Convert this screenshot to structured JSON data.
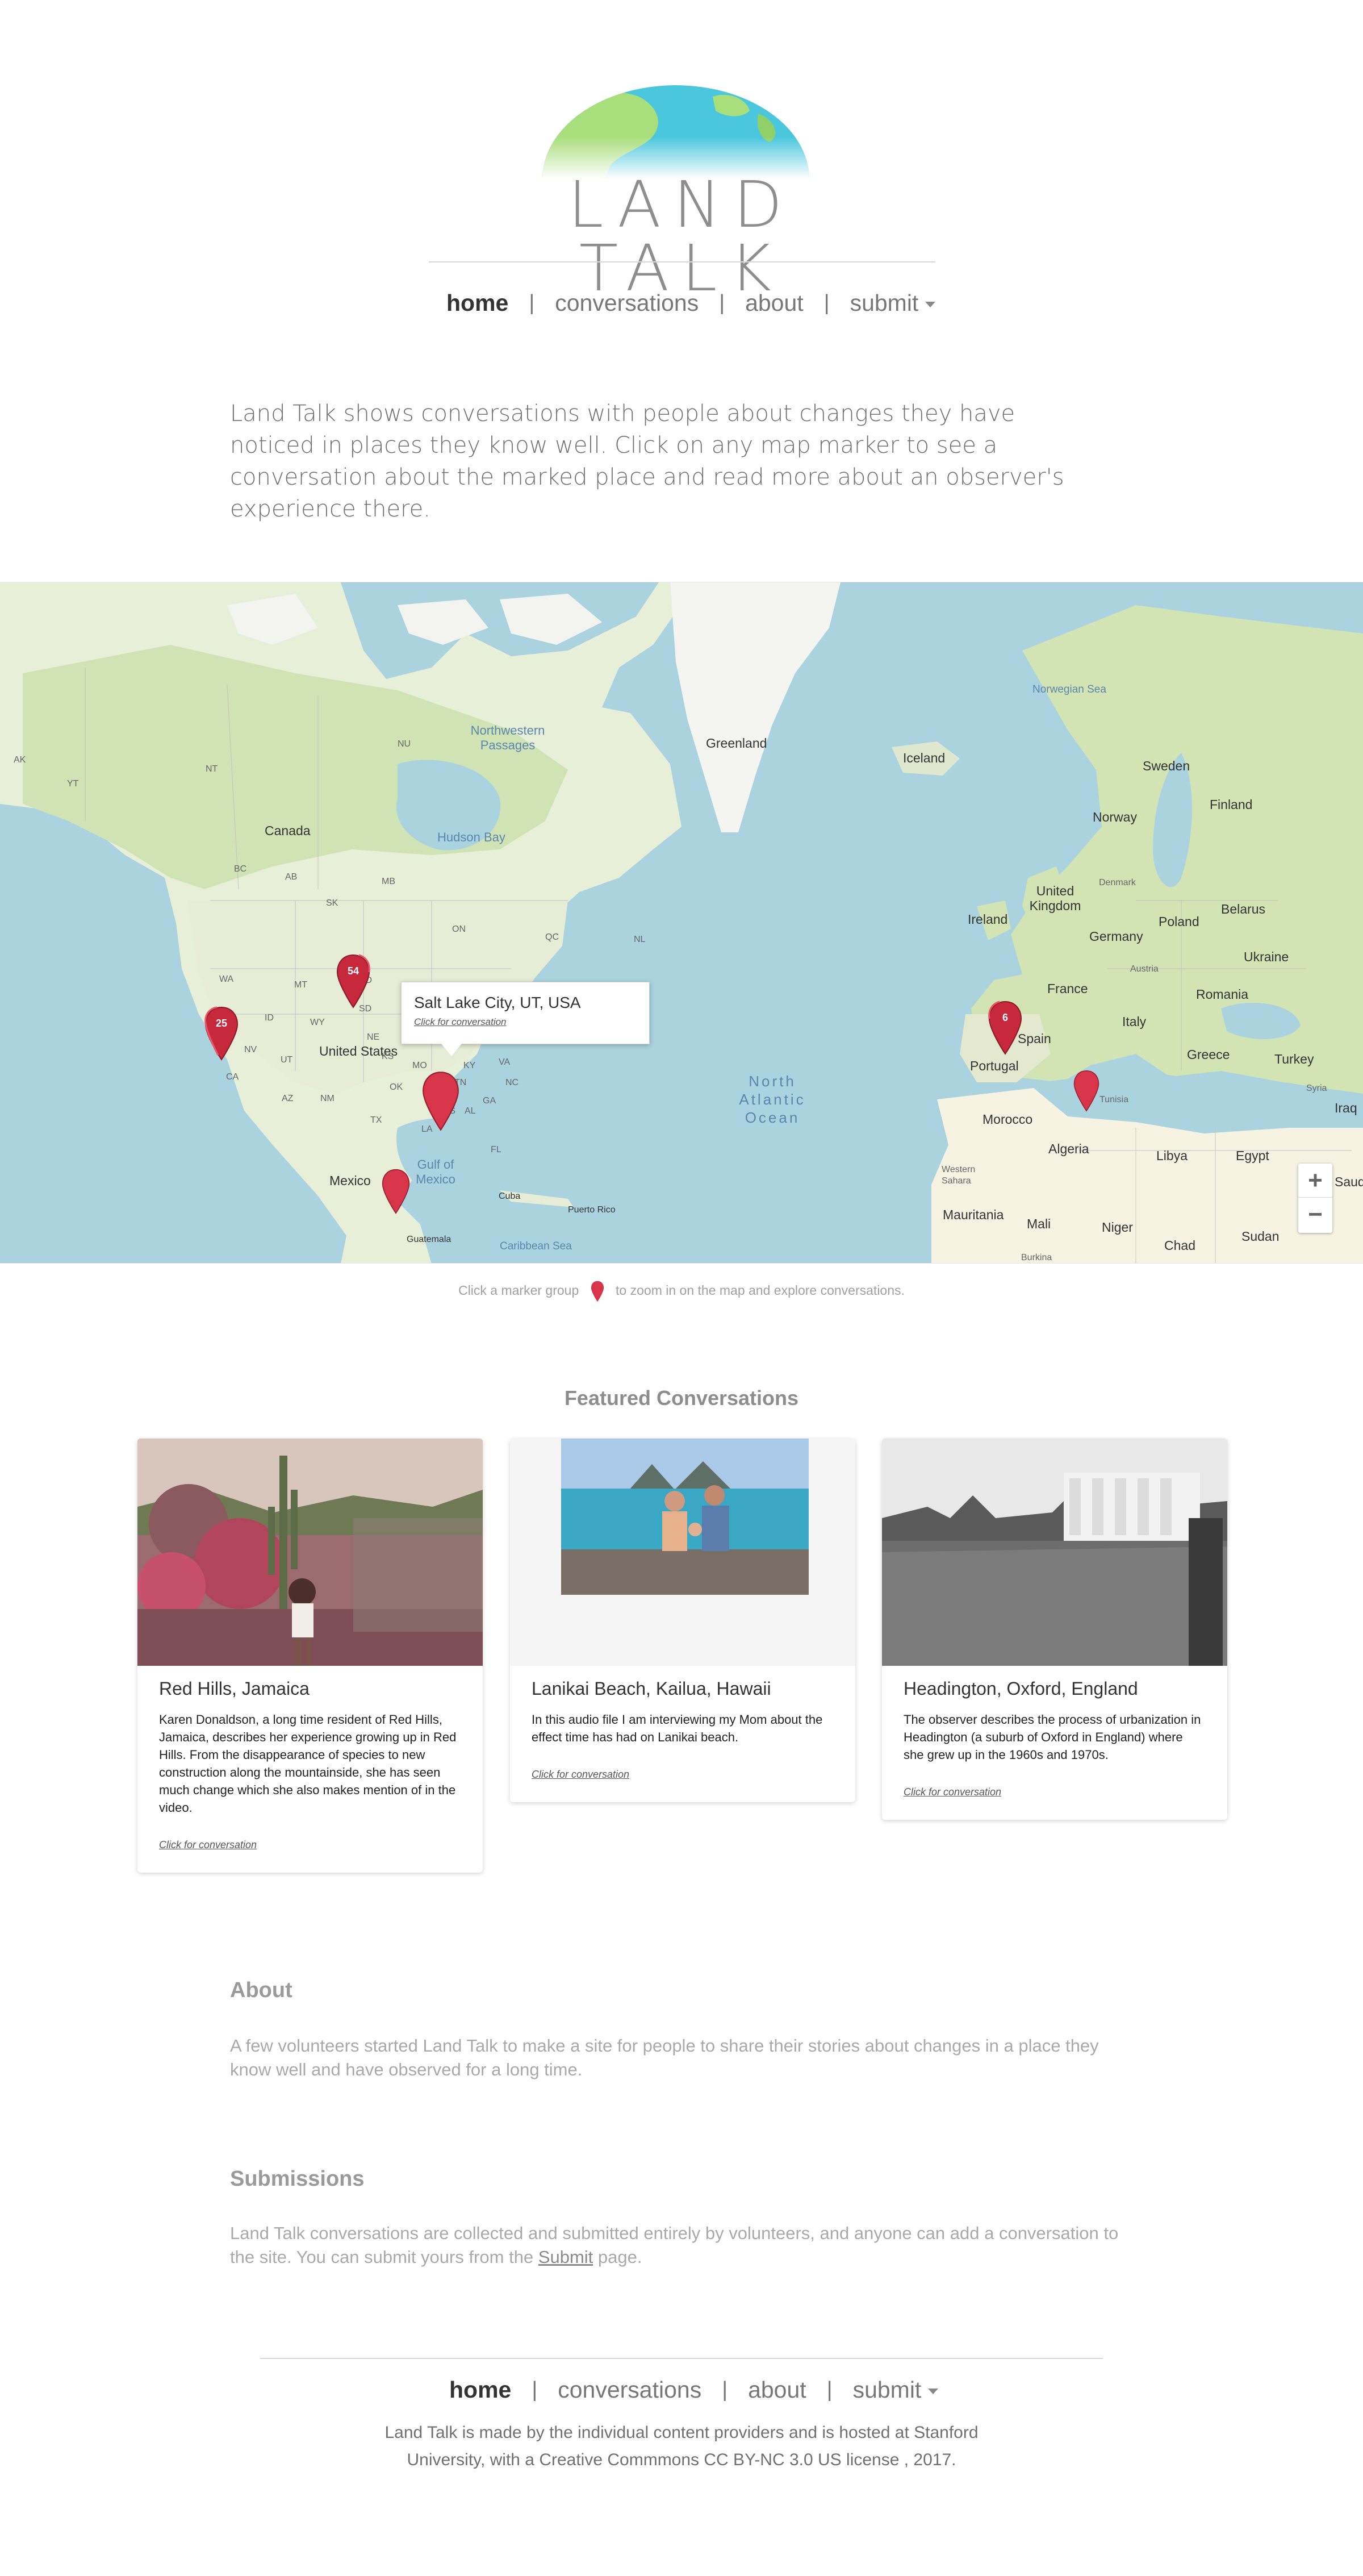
{
  "brand": {
    "name": "LAND TALK",
    "colors": {
      "globe_land": "#a8de7c",
      "globe_water": "#4ac6dd",
      "accent_marker": "#d8344a"
    }
  },
  "nav": {
    "home": "home",
    "conversations": "conversations",
    "about": "about",
    "submit": "submit",
    "separator": "|"
  },
  "intro": "Land Talk shows conversations with people about changes they have noticed in places they know well.  Click on any map marker to see a conversation about the marked place and read more about an observer's experience there.",
  "map": {
    "labels": {
      "greenland": "Greenland",
      "iceland": "Iceland",
      "norwegian_sea": "Norwegian Sea",
      "sweden": "Sweden",
      "finland": "Finland",
      "norway": "Norway",
      "denmark": "Denmark",
      "united_kingdom": "United Kingdom",
      "ireland": "Ireland",
      "belarus": "Belarus",
      "poland": "Poland",
      "germany": "Germany",
      "ukraine": "Ukraine",
      "austria": "Austria",
      "france": "France",
      "romania": "Romania",
      "italy": "Italy",
      "spain": "Spain",
      "portugal": "Portugal",
      "greece": "Greece",
      "turkey": "Turkey",
      "syria": "Syria",
      "iraq": "Iraq",
      "tunisia": "Tunisia",
      "morocco": "Morocco",
      "algeria": "Algeria",
      "libya": "Libya",
      "egypt": "Egypt",
      "western_sahara": "Western Sahara",
      "mauritania": "Mauritania",
      "mali": "Mali",
      "niger": "Niger",
      "chad": "Chad",
      "sudan": "Sudan",
      "burkina": "Burkina",
      "saudi": "Saudi A",
      "north_atlantic_ocean": "North Atlantic Ocean",
      "canada": "Canada",
      "hudson_bay": "Hudson Bay",
      "northwestern_passages": "Northwestern Passages",
      "united_states": "United States",
      "mexico": "Mexico",
      "gulf_of_mexico": "Gulf of Mexico",
      "cuba": "Cuba",
      "puerto_rico": "Puerto Rico",
      "caribbean_sea": "Caribbean Sea",
      "guatemala": "Guatemala",
      "ak": "AK",
      "yt": "YT",
      "nt": "NT",
      "nu": "NU",
      "bc": "BC",
      "ab": "AB",
      "sk": "SK",
      "mb": "MB",
      "on": "ON",
      "qc": "QC",
      "nl": "NL",
      "mt": "MT",
      "nd": "ND",
      "sd": "SD",
      "wa": "WA",
      "or": "OR",
      "id": "ID",
      "wy": "WY",
      "nv": "NV",
      "ut": "UT",
      "ca": "CA",
      "az": "AZ",
      "nm": "NM",
      "ne": "NE",
      "ks": "KS",
      "mo": "MO",
      "ky": "KY",
      "tx": "TX",
      "la": "LA",
      "ga": "GA",
      "fl": "FL",
      "va": "VA",
      "nc": "NC",
      "tn": "TN",
      "ms": "MS",
      "al": "AL",
      "ok": "OK"
    },
    "markers": {
      "group_ca": "25",
      "group_nd": "54",
      "group_spain": "6"
    },
    "popup": {
      "title": "Salt Lake City, UT, USA",
      "link": "Click for conversation"
    },
    "zoom_in": "+",
    "zoom_out": "−",
    "hint_before": "Click a marker group",
    "hint_after": "to zoom in on the map and explore conversations."
  },
  "featured": {
    "title": "Featured Conversations",
    "cards": [
      {
        "title": "Red Hills, Jamaica",
        "desc": "Karen Donaldson, a long time resident of Red Hills, Jamaica, describes her experience growing up in Red Hills. From the disappearance of species to new construction along the mountainside, she has seen much change which she also makes mention of in the video.",
        "link": "Click for conversation"
      },
      {
        "title": "Lanikai Beach, Kailua, Hawaii",
        "desc": "In this audio file I am interviewing my Mom about the effect time has had on Lanikai beach.",
        "link": "Click for conversation"
      },
      {
        "title": "Headington, Oxford, England",
        "desc": "The observer describes the process of urbanization in Headington (a suburb of Oxford in England) where she grew up in the 1960s and 1970s.",
        "link": "Click for conversation"
      }
    ]
  },
  "about": {
    "title": "About",
    "text": "A few volunteers started Land Talk to make a site for people to share their stories about changes in a place they know well and have observed for a long time."
  },
  "submissions": {
    "title": "Submissions",
    "text_before": "Land Talk conversations are collected and submitted entirely by volunteers, and anyone can add a conversation to the site.  You can submit yours from the ",
    "link": "Submit",
    "text_after": " page."
  },
  "footer": {
    "line1": "Land Talk is made by the individual content providers and is hosted at Stanford",
    "line2": "University, with a Creative Commmons CC BY-NC 3.0 US license , 2017."
  }
}
